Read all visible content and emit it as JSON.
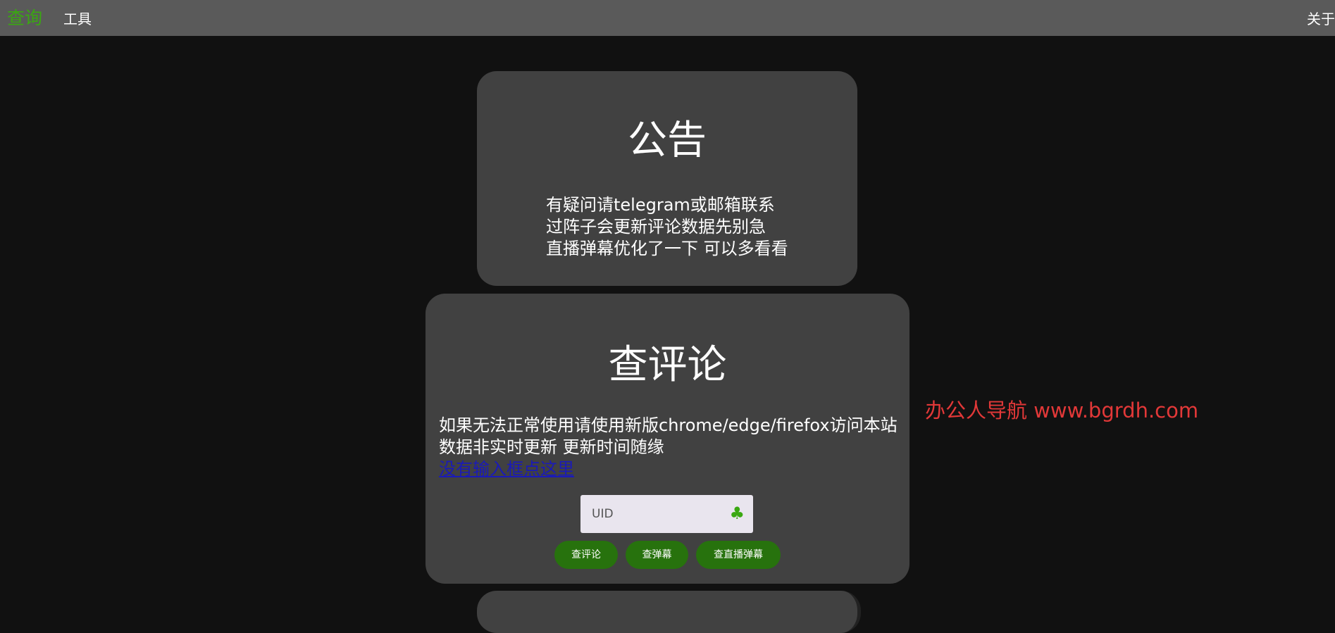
{
  "nav": {
    "query": "查询",
    "tools": "工具",
    "about": "关于"
  },
  "notice": {
    "title": "公告",
    "lines": [
      "有疑问请telegram或邮箱联系",
      "过阵子会更新评论数据先别急",
      "直播弹幕优化了一下 可以多看看"
    ]
  },
  "query": {
    "title": "查评论",
    "lines": [
      "如果无法正常使用请使用新版chrome/edge/firefox访问本站",
      "数据非实时更新 更新时间随缘"
    ],
    "link": "没有输入框点这里",
    "input_placeholder": "UID",
    "input_icon": "clover-icon",
    "buttons": {
      "comment": "查评论",
      "danmaku": "查弹幕",
      "live": "查直播弹幕"
    }
  },
  "watermark": "办公人导航 www.bgrdh.com",
  "colors": {
    "accent": "#3aa811",
    "button": "#27720d",
    "card": "#414141",
    "watermark": "#e23838"
  }
}
